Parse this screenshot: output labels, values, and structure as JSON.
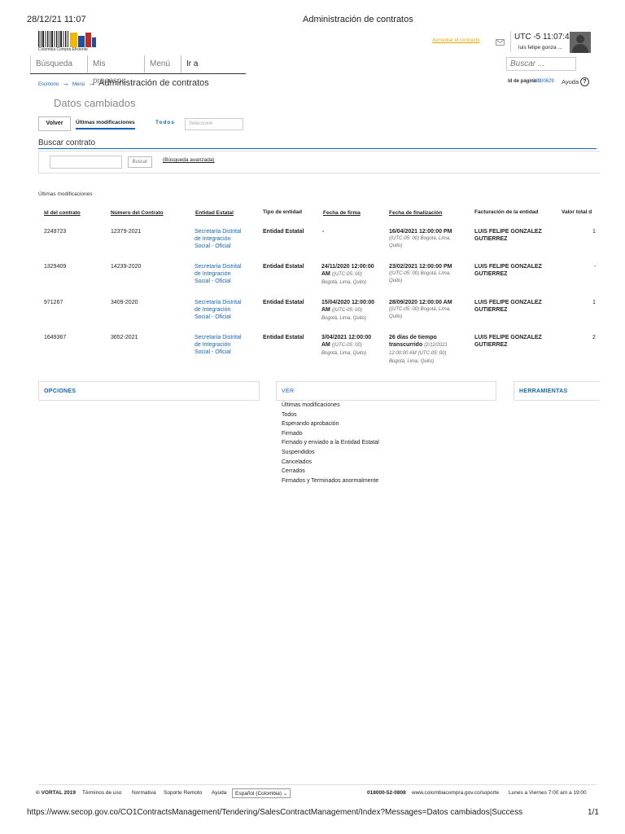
{
  "print_header": {
    "datetime": "28/12/21 11:07",
    "title": "Administración de contratos"
  },
  "logo": {
    "label": "Colombia Compra Eficiente"
  },
  "nav": {
    "items": [
      "Búsqueda",
      "Mis procesos",
      "Menú",
      "Ir a"
    ]
  },
  "header": {
    "contrast_link": "Aumentar el contraste",
    "clock": "UTC -5 11:07:44",
    "user": "luis felipe gonza ...",
    "search_placeholder": "Buscar ..."
  },
  "breadcrumb": {
    "home": "Escritorio",
    "menu": "Menú",
    "current": "Administración de contratos"
  },
  "page_info": {
    "id_label": "Id de página ::",
    "id_value": "23000629",
    "help": "Ayuda"
  },
  "section_title": "Datos cambiados",
  "toolbar": {
    "back": "Volver",
    "tab_last": "Últimas modificaciones",
    "tab_all": "Todos",
    "select_placeholder": "Seleccione"
  },
  "search": {
    "title": "Buscar contrato",
    "button": "Buscar",
    "advanced": "(Búsqueda avanzada)"
  },
  "table": {
    "caption": "Últimas modificaciones",
    "headers": [
      "Id del contrato",
      "Número del Contrato",
      "Entidad Estatal",
      "Tipo de entidad",
      "Fecha de firma",
      "Fecha de finalización",
      "Facturación de la entidad",
      "Valor total d"
    ],
    "rows": [
      {
        "id": "2249723",
        "number": "12379-2021",
        "entity": "Secretaría Distrital de Integración Social - Oficial",
        "type": "Entidad Estatal",
        "sign": "-",
        "sign_note": "",
        "end": "16/04/2021 12:00:00 PM",
        "end_note": "((UTC-05: 00) Bogotá, Lima, Quito)",
        "billing": "LUIS FELIPE GONZALEZ GUTIERREZ",
        "value": "1"
      },
      {
        "id": "1329409",
        "number": "14239-2020",
        "entity": "Secretaría Distrital de Integración Social - Oficial",
        "type": "Entidad Estatal",
        "sign": "24/11/2020 12:00:00 AM",
        "sign_note": "((UTC-05: 00) Bogotá, Lima, Quito)",
        "end": "23/02/2021 12:00:00 PM",
        "end_note": "((UTC-05: 00) Bogotá, Lima, Quito)",
        "billing": "LUIS FELIPE GONZALEZ GUTIERREZ",
        "value": "-"
      },
      {
        "id": "971267",
        "number": "3409-2020",
        "entity": "Secretaría Distrital de Integración Social - Oficial",
        "type": "Entidad Estatal",
        "sign": "15/04/2020 12:00:00 AM",
        "sign_note": "((UTC-05: 00) Bogotá, Lima, Quito)",
        "end": "28/09/2020 12:00:00 AM",
        "end_note": "((UTC-05: 00) Bogotá, Lima, Quito)",
        "billing": "LUIS FELIPE GONZALEZ GUTIERREZ",
        "value": "1"
      },
      {
        "id": "1649367",
        "number": "3652-2021",
        "entity": "Secretaría Distrital de Integración Social - Oficial",
        "type": "Entidad Estatal",
        "sign": "3/04/2021 12:00:00 AM",
        "sign_note": "((UTC-05: 00) Bogotá, Lima, Quito)",
        "end": "26 días de tiempo transcurrido",
        "end_note": "(2/12/2021 12:00:00 AM (UTC-05: 00) Bogotá, Lima, Quito)",
        "billing": "LUIS FELIPE GONZALEZ GUTIERREZ",
        "value": "2"
      }
    ]
  },
  "panels": {
    "options": "OPCIONES",
    "view": "VER",
    "tools": "HERRAMIENTAS"
  },
  "view_list": [
    "Últimas modificaciones",
    "Todos",
    "Esperando aprobación",
    "Firmado",
    "Firmado y enviado a la Entidad Estatal",
    "Suspendidos",
    "Cancelados",
    "Cerrados",
    "Firmados y Terminados anormalmente"
  ],
  "footer": {
    "copyright": "© VORTAL 2019",
    "terms": "Términos de uso",
    "rules": "Normativa",
    "remote": "Soporte Remoto",
    "help": "Ayuda",
    "language": "Español (Colombia)",
    "phone": "018000-52-0808",
    "support_url": "www.colombiacompra.gov.co/soporte",
    "hours": "Lunes a Viernes 7:00 am a 19:00"
  },
  "print_footer": {
    "url": "https://www.secop.gov.co/CO1ContractsManagement/Tendering/SalesContractManagement/Index?Messages=Datos cambiados|Success",
    "page": "1/1"
  }
}
